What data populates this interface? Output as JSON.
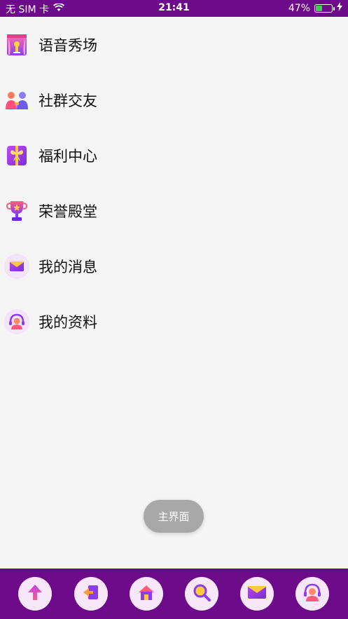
{
  "status_bar": {
    "carrier": "无 SIM 卡",
    "time": "21:41",
    "battery_percent": "47%",
    "battery_level": 0.47
  },
  "menu": {
    "items": [
      {
        "label": "语音秀场",
        "icon": "stage-curtain-icon"
      },
      {
        "label": "社群交友",
        "icon": "people-icon"
      },
      {
        "label": "福利中心",
        "icon": "gift-icon"
      },
      {
        "label": "荣誉殿堂",
        "icon": "trophy-icon"
      },
      {
        "label": "我的消息",
        "icon": "envelope-icon"
      },
      {
        "label": "我的资料",
        "icon": "profile-headset-icon"
      }
    ]
  },
  "toast": {
    "text": "主界面"
  },
  "bottom_nav": {
    "items": [
      {
        "icon": "arrow-up-icon"
      },
      {
        "icon": "exit-icon"
      },
      {
        "icon": "home-icon"
      },
      {
        "icon": "search-icon"
      },
      {
        "icon": "envelope-icon"
      },
      {
        "icon": "profile-headset-icon"
      }
    ]
  },
  "colors": {
    "brand_purple": "#6d0a8a",
    "background": "#f5f5f5",
    "toast_bg": "#a8a8a8",
    "nav_button_bg": "#f8e6fb"
  }
}
